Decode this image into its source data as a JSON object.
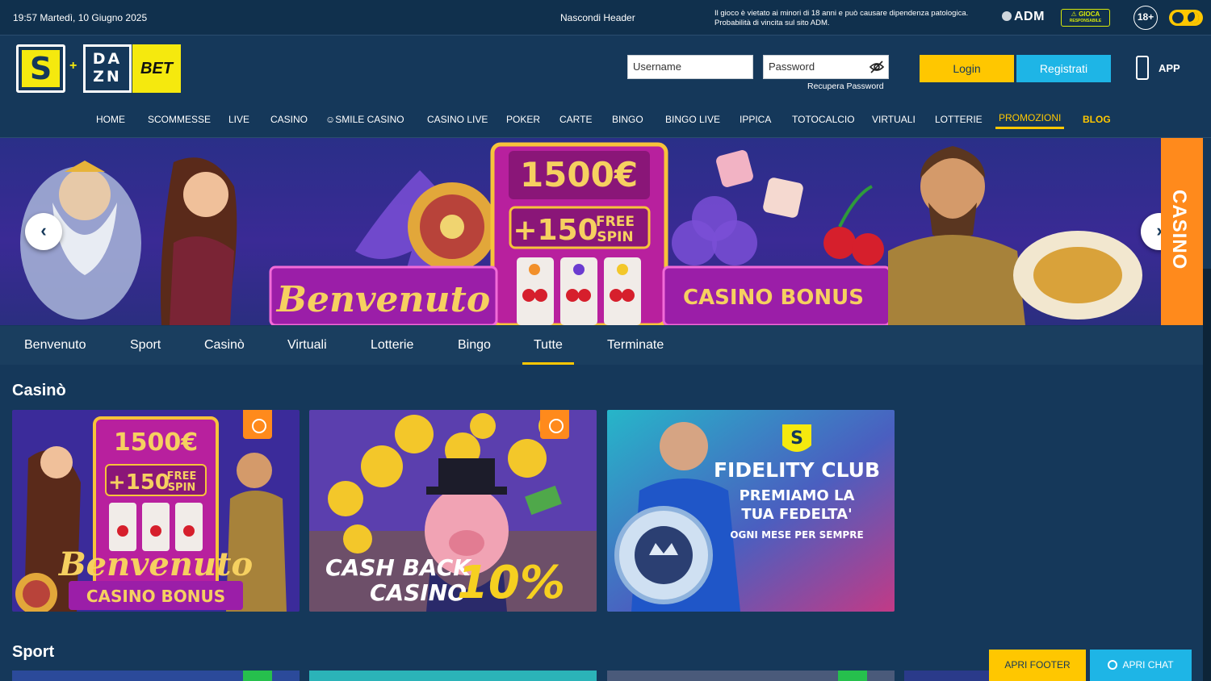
{
  "topbar": {
    "datetime": "19:57 Martedì, 10 Giugno 2025",
    "hide_header": "Nascondi Header",
    "legal_line1": "Il gioco è vietato ai minori di 18 anni e può causare dipendenza patologica.",
    "legal_line2": "Probabilità di vincita sul sito ADM.",
    "adm": "ADM",
    "gioca": "GIOCA",
    "gioca_sub": "RESPONSABILE",
    "age": "18+"
  },
  "logo": {
    "s": "S",
    "plus": "+",
    "dazn_line1": "DA",
    "dazn_line2": "ZN",
    "bet": "BET"
  },
  "login": {
    "username_placeholder": "Username",
    "password_placeholder": "Password",
    "recover": "Recupera Password",
    "login_label": "Login",
    "register_label": "Registrati",
    "app_label": "APP"
  },
  "nav": [
    "HOME",
    "SCOMMESSE",
    "LIVE",
    "CASINO",
    "SMILE CASINO",
    "CASINO LIVE",
    "POKER",
    "CARTE",
    "BINGO",
    "BINGO LIVE",
    "IPPICA",
    "TOTOCALCIO",
    "VIRTUALI",
    "LOTTERIE",
    "PROMOZIONI",
    "BLOG"
  ],
  "banner": {
    "amount": "1500€",
    "spins": "+150",
    "free": "FREE",
    "spin": "SPIN",
    "welcome": "Benvenuto",
    "bonus": "CASINO BONUS",
    "side_tab": "CASINO"
  },
  "tabs": [
    "Benvenuto",
    "Sport",
    "Casinò",
    "Virtuali",
    "Lotterie",
    "Bingo",
    "Tutte",
    "Terminate"
  ],
  "active_tab": "Tutte",
  "sections": {
    "casino_title": "Casinò",
    "sport_title": "Sport"
  },
  "cards": {
    "card1": {
      "amount": "1500€",
      "spins": "+150",
      "free": "FREE",
      "spin": "SPIN",
      "welcome": "Benvenuto",
      "bonus": "CASINO BONUS"
    },
    "card2": {
      "line1": "CASH BACK",
      "line2": "CASINO",
      "percent": "10%"
    },
    "card3": {
      "badge": "S",
      "title": "FIDELITY CLUB",
      "line1": "PREMIAMO LA",
      "line2": "TUA FEDELTA'",
      "line3": "OGNI MESE PER SEMPRE"
    }
  },
  "bottom_buttons": {
    "footer": "APRI FOOTER",
    "chat": "APRI CHAT"
  },
  "colors": {
    "accent": "#ffc700",
    "secondary": "#1eb5e6",
    "background": "#15385a",
    "orange": "#ff8a1c"
  }
}
